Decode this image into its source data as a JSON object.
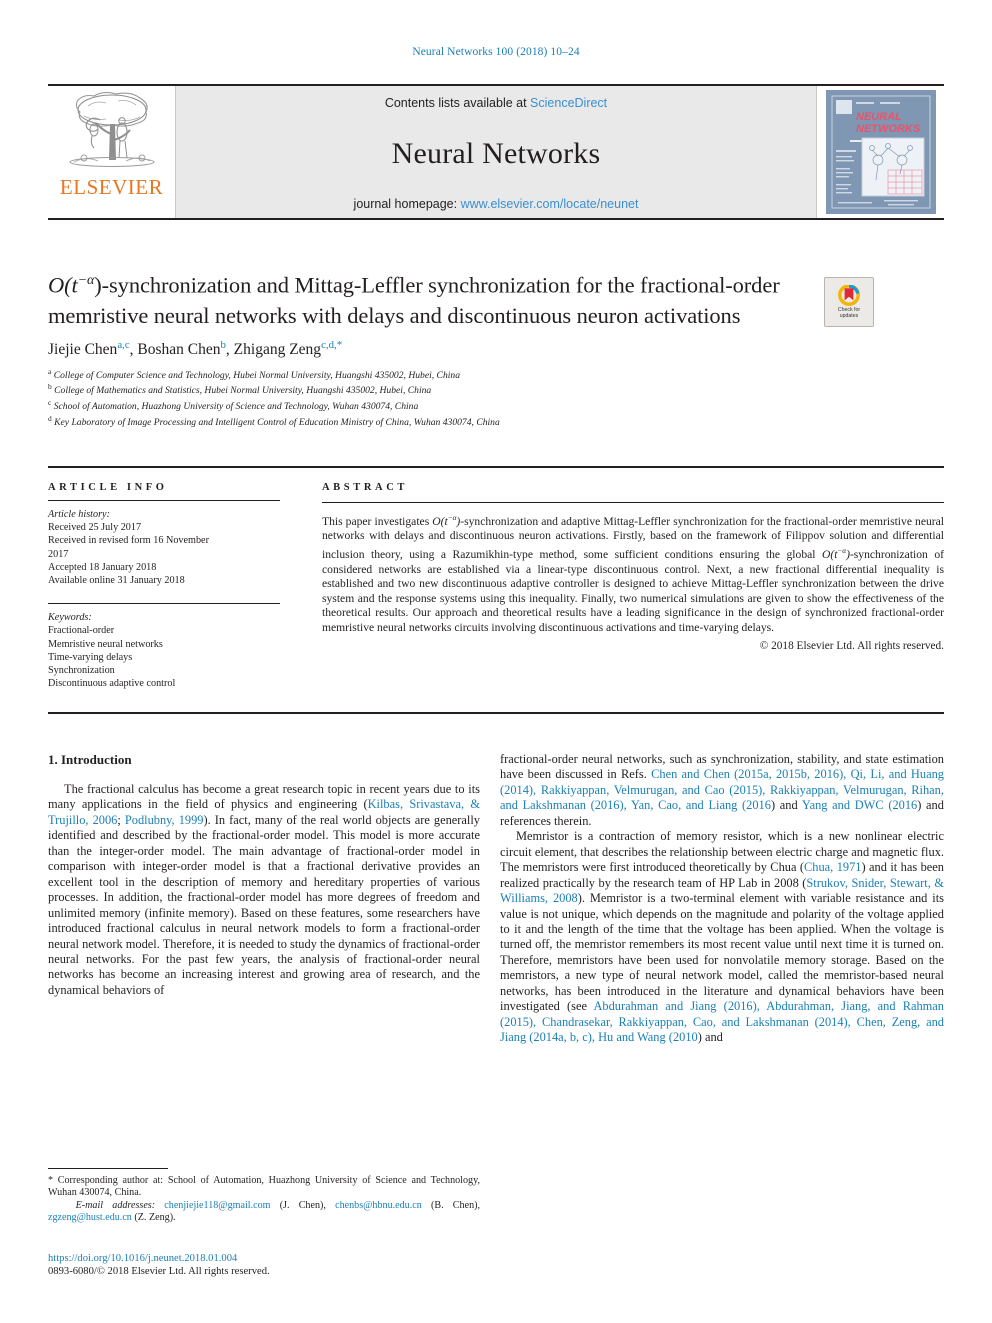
{
  "running_head": "Neural Networks 100 (2018) 10–24",
  "masthead": {
    "publisher_name": "ELSEVIER",
    "contents_prefix": "Contents lists available at ",
    "contents_link": "ScienceDirect",
    "journal_title": "Neural Networks",
    "homepage_prefix": "journal homepage: ",
    "homepage_url": "www.elsevier.com/locate/neunet",
    "cover_title_line1": "NEURAL",
    "cover_title_line2": "NETWORKS"
  },
  "crossmark": {
    "line1": "Check for",
    "line2": "updates"
  },
  "title": {
    "line1_a": "O(t",
    "line1_sup": "−α",
    "line1_b": ")-synchronization and Mittag-Leffler synchronization for the",
    "line2": "fractional-order memristive neural networks with delays and",
    "line3": "discontinuous neuron activations"
  },
  "authors": [
    {
      "name": "Jiejie Chen",
      "marks": "a,c",
      "sep": ", "
    },
    {
      "name": "Boshan Chen",
      "marks": "b",
      "sep": ", "
    },
    {
      "name": "Zhigang Zeng",
      "marks": "c,d,*",
      "sep": ""
    }
  ],
  "affiliations": [
    {
      "mark": "a",
      "text": "College of Computer Science and Technology, Hubei Normal University, Huangshi 435002, Hubei, China"
    },
    {
      "mark": "b",
      "text": "College of Mathematics and Statistics, Hubei Normal University, Huangshi 435002, Hubei, China"
    },
    {
      "mark": "c",
      "text": "School of Automation, Huazhong University of Science and Technology, Wuhan 430074, China"
    },
    {
      "mark": "d",
      "text": "Key Laboratory of Image Processing and Intelligent Control of Education Ministry of China, Wuhan 430074, China"
    }
  ],
  "article_info": {
    "heading": "ARTICLE INFO",
    "history_label": "Article history:",
    "history": [
      "Received 25 July 2017",
      "Received in revised form 16 November",
      "2017",
      "Accepted 18 January 2018",
      "Available online 31 January 2018"
    ],
    "keywords_label": "Keywords:",
    "keywords": [
      "Fractional-order",
      "Memristive neural networks",
      "Time-varying delays",
      "Synchronization",
      "Discontinuous adaptive control"
    ]
  },
  "abstract": {
    "heading": "ABSTRACT",
    "part1": "This paper investigates ",
    "math1_a": "O(t",
    "math1_sup": "−α",
    "math1_b": ")",
    "part2": "-synchronization and adaptive Mittag-Leffler synchronization for the fractional-order memristive neural networks with delays and discontinuous neuron activations. Firstly, based on the framework of Filippov solution and differential inclusion theory, using a Razumikhin-type method, some sufficient conditions ensuring the global ",
    "math2_a": "O(t",
    "math2_sup": "−α",
    "math2_b": ")",
    "part3": "-synchronization of considered networks are established via a linear-type discontinuous control. Next, a new fractional differential inequality is established and two new discontinuous adaptive controller is designed to achieve Mittag-Leffler synchronization between the drive system and the response systems using this inequality. Finally, two numerical simulations are given to show the effectiveness of the theoretical results. Our approach and theoretical results have a leading significance in the design of synchronized fractional-order memristive neural networks circuits involving discontinuous activations and time-varying delays.",
    "copyright": "© 2018 Elsevier Ltd. All rights reserved."
  },
  "introduction": {
    "section_title": "1. Introduction",
    "left_para1_a": "The fractional calculus has become a great research topic in recent years due to its many applications in the field of physics and engineering (",
    "left_para1_ref1": "Kilbas, Srivastava, & Trujillo, 2006",
    "left_para1_b": "; ",
    "left_para1_ref2": "Podlubny, 1999",
    "left_para1_c": "). In fact, many of the real world objects are generally identified and described by the fractional-order model. This model is more accurate than the integer-order model. The main advantage of fractional-order model in comparison with integer-order model is that a fractional derivative provides an excellent tool in the description of memory and hereditary properties of various processes. In addition, the fractional-order model has more degrees of freedom and unlimited memory (infinite memory). Based on these features, some researchers have introduced fractional calculus in neural network models to form a fractional-order neural network model. Therefore, it is needed to study the dynamics of fractional-order neural networks. For the past few years, the analysis of fractional-order neural networks has become an increasing interest and growing area of research, and the dynamical behaviors of",
    "right_para1_a": "fractional-order neural networks, such as synchronization, stability, and state estimation have been  discussed in Refs. ",
    "right_para1_ref1": "Chen and Chen",
    "right_para1_b": " (",
    "right_para1_ref2": "2015a, 2015b, 2016",
    "right_para1_c": "), ",
    "right_para1_ref3": "Qi, Li, and Huang",
    "right_para1_d": " (",
    "right_para1_ref4": "2014",
    "right_para1_e": "), ",
    "right_para1_ref5": "Rakkiyappan, Velmurugan, and Cao",
    "right_para1_f": " (",
    "right_para1_ref6": "2015",
    "right_para1_g": "), ",
    "right_para1_ref7": "Rakkiyappan, Velmurugan, Rihan, and Lakshmanan",
    "right_para1_h": " (",
    "right_para1_ref8": "2016",
    "right_para1_i": "), ",
    "right_para1_ref9": "Yan, Cao, and Liang",
    "right_para1_j": " (",
    "right_para1_ref10": "2016",
    "right_para1_k": ") and ",
    "right_para1_ref11": "Yang and DWC",
    "right_para1_l": " (",
    "right_para1_ref12": "2016",
    "right_para1_m": ") and references therein.",
    "right_para2_a": "Memristor is a contraction of memory resistor, which is a new nonlinear electric circuit element, that describes the relationship between electric charge and magnetic flux. The  memristors were first introduced theoretically by Chua (",
    "right_para2_ref1": "Chua, 1971",
    "right_para2_b": ") and it has been realized practically by the research team of HP Lab in 2008 (",
    "right_para2_ref2": "Strukov, Snider, Stewart, & Williams, 2008",
    "right_para2_c": "). Memristor is a two-terminal element with variable resistance and its value is not unique, which depends on the magnitude and polarity of the voltage applied to it and the length of the time that the voltage has been applied. When the voltage is turned off, the memristor remembers its most recent value until next time it is turned on. Therefore, memristors have been used for nonvolatile memory storage. Based on the memristors, a new type of neural network model, called the memristor-based neural networks, has been introduced in the literature and dynamical behaviors have been investigated (see ",
    "right_para2_ref3": "Abdurahman and Jiang",
    "right_para2_d": " (",
    "right_para2_ref4": "2016",
    "right_para2_e": "), ",
    "right_para2_ref5": "Abdurahman, Jiang, and Rahman",
    "right_para2_f": " (",
    "right_para2_ref6": "2015",
    "right_para2_g": "), ",
    "right_para2_ref7": "Chandrasekar, Rakkiyappan, Cao, and Lakshmanan",
    "right_para2_h": " (",
    "right_para2_ref8": "2014",
    "right_para2_i": "), ",
    "right_para2_ref9": "Chen, Zeng, and Jiang",
    "right_para2_j": " (",
    "right_para2_ref10": "2014a, b, c",
    "right_para2_k": "), ",
    "right_para2_ref11": "Hu and Wang",
    "right_para2_l": " (",
    "right_para2_ref12": "2010",
    "right_para2_m": ") and"
  },
  "footnote": {
    "corresponding": "* Corresponding author at: School of Automation, Huazhong University of Science and Technology, Wuhan 430074, China.",
    "email_label": "E-mail addresses:",
    "email1": "chenjiejie118@gmail.com",
    "email1_owner": " (J. Chen), ",
    "email2": "chenbs@hbnu.edu.cn",
    "email2_owner": " (B. Chen), ",
    "email3": "zgzeng@hust.edu.cn",
    "email3_owner": " (Z. Zeng)."
  },
  "doi": {
    "url": "https://doi.org/10.1016/j.neunet.2018.01.004",
    "issn": "0893-6080/© 2018 Elsevier Ltd. All rights reserved."
  },
  "colors": {
    "link": "#1a7fb5",
    "elsevier_orange": "#e87722",
    "sciencedirect_blue": "#3b8fd0",
    "masthead_gray": "#e9e9e9",
    "text": "#231f20"
  }
}
